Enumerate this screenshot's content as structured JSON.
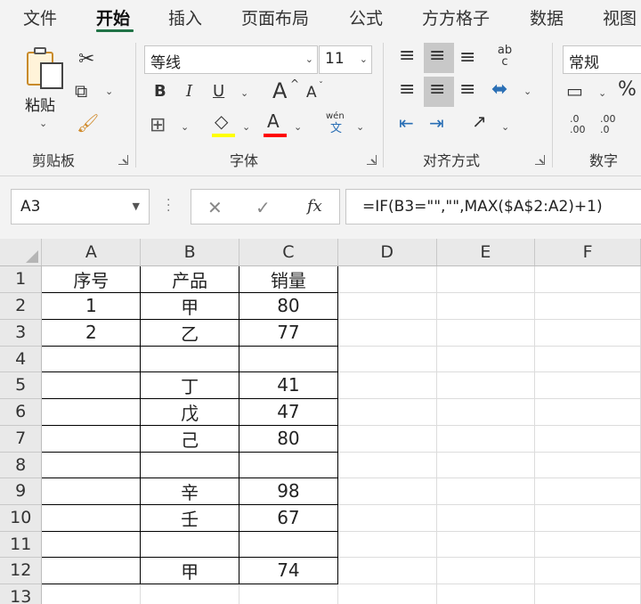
{
  "menu": {
    "tabs": [
      {
        "label": "文件"
      },
      {
        "label": "开始"
      },
      {
        "label": "插入"
      },
      {
        "label": "页面布局"
      },
      {
        "label": "公式"
      },
      {
        "label": "方方格子"
      },
      {
        "label": "数据"
      },
      {
        "label": "视图"
      }
    ],
    "active_tab": "开始"
  },
  "ribbon": {
    "clipboard": {
      "group_label": "剪贴板",
      "paste_label": "粘贴"
    },
    "font": {
      "group_label": "字体",
      "font_name": "等线",
      "font_size": "11",
      "bold": "B",
      "italic": "I",
      "underline": "U",
      "grow": "A",
      "shrink": "A",
      "phonetic_top": "wén",
      "phonetic_bottom": "文",
      "fill_color": "#ffff00",
      "font_color": "#ff0000"
    },
    "alignment": {
      "group_label": "对齐方式",
      "wrap_glyph": "ab c"
    },
    "number": {
      "group_label": "数字",
      "format": "常规",
      "percent": "%",
      "dec_inc_a": ".0",
      "dec_inc_b": ".00",
      "dec_dec_a": ".00",
      "dec_dec_b": ".0"
    }
  },
  "formula_bar": {
    "name_box": "A3",
    "fx_label": "fx",
    "formula": "=IF(B3=\"\",\"\",MAX($A$2:A2)+1)"
  },
  "sheet": {
    "columns": [
      "A",
      "B",
      "C",
      "D",
      "E",
      "F"
    ],
    "rows": [
      {
        "num": "1",
        "a": "序号",
        "b": "产品",
        "c": "销量"
      },
      {
        "num": "2",
        "a": "1",
        "b": "甲",
        "c": "80"
      },
      {
        "num": "3",
        "a": "2",
        "b": "乙",
        "c": "77"
      },
      {
        "num": "4",
        "a": "",
        "b": "",
        "c": ""
      },
      {
        "num": "5",
        "a": "",
        "b": "丁",
        "c": "41"
      },
      {
        "num": "6",
        "a": "",
        "b": "戊",
        "c": "47"
      },
      {
        "num": "7",
        "a": "",
        "b": "己",
        "c": "80"
      },
      {
        "num": "8",
        "a": "",
        "b": "",
        "c": ""
      },
      {
        "num": "9",
        "a": "",
        "b": "辛",
        "c": "98"
      },
      {
        "num": "10",
        "a": "",
        "b": "壬",
        "c": "67"
      },
      {
        "num": "11",
        "a": "",
        "b": "",
        "c": ""
      },
      {
        "num": "12",
        "a": "",
        "b": "甲",
        "c": "74"
      },
      {
        "num": "13",
        "a": "",
        "b": "",
        "c": ""
      }
    ]
  },
  "colors": {
    "accent": "#217346",
    "ribbon_bg": "#f3f3f3",
    "header_bg": "#e9e9e9"
  }
}
